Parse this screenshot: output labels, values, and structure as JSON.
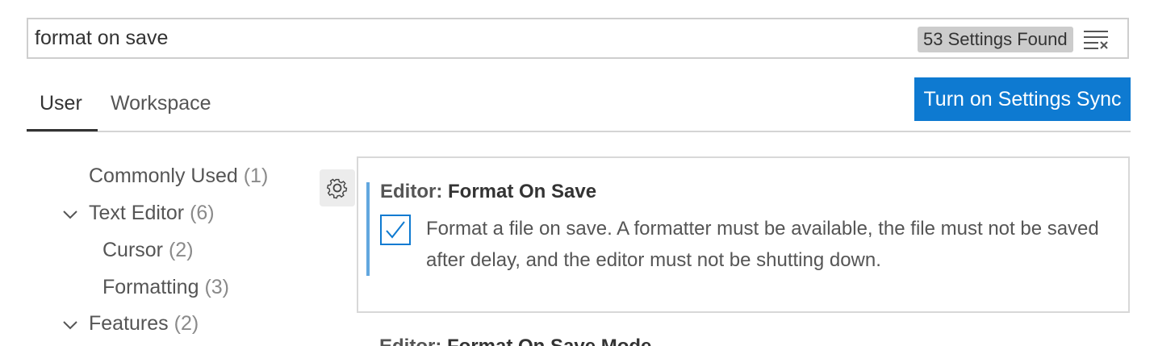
{
  "search": {
    "value": "format on save",
    "result_count": "53 Settings Found"
  },
  "tabs": [
    {
      "label": "User",
      "active": true
    },
    {
      "label": "Workspace",
      "active": false
    }
  ],
  "sync_button": {
    "label": "Turn on Settings Sync"
  },
  "toc": [
    {
      "label": "Commonly Used",
      "count": "(1)",
      "expandable": false
    },
    {
      "label": "Text Editor",
      "count": "(6)",
      "expandable": true,
      "expanded": true
    },
    {
      "label": "Cursor",
      "count": "(2)",
      "expandable": false
    },
    {
      "label": "Formatting",
      "count": "(3)",
      "expandable": false
    },
    {
      "label": "Features",
      "count": "(2)",
      "expandable": true,
      "expanded": true
    }
  ],
  "setting": {
    "category": "Editor:",
    "name": "Format On Save",
    "checked": true,
    "description": "Format a file on save. A formatter must be available, the file must not be saved after delay, and the editor must not be shutting down."
  },
  "next_setting": {
    "category": "Editor:",
    "name": "Format On Save Mode"
  },
  "icons": {
    "clear": "clear-filter-icon",
    "gear": "gear-icon",
    "chevron": "chevron-down-icon",
    "check": "check-icon"
  },
  "colors": {
    "accent": "#0e7ad1",
    "focus_bar": "#62a7df",
    "badge_bg": "#cccccc"
  }
}
